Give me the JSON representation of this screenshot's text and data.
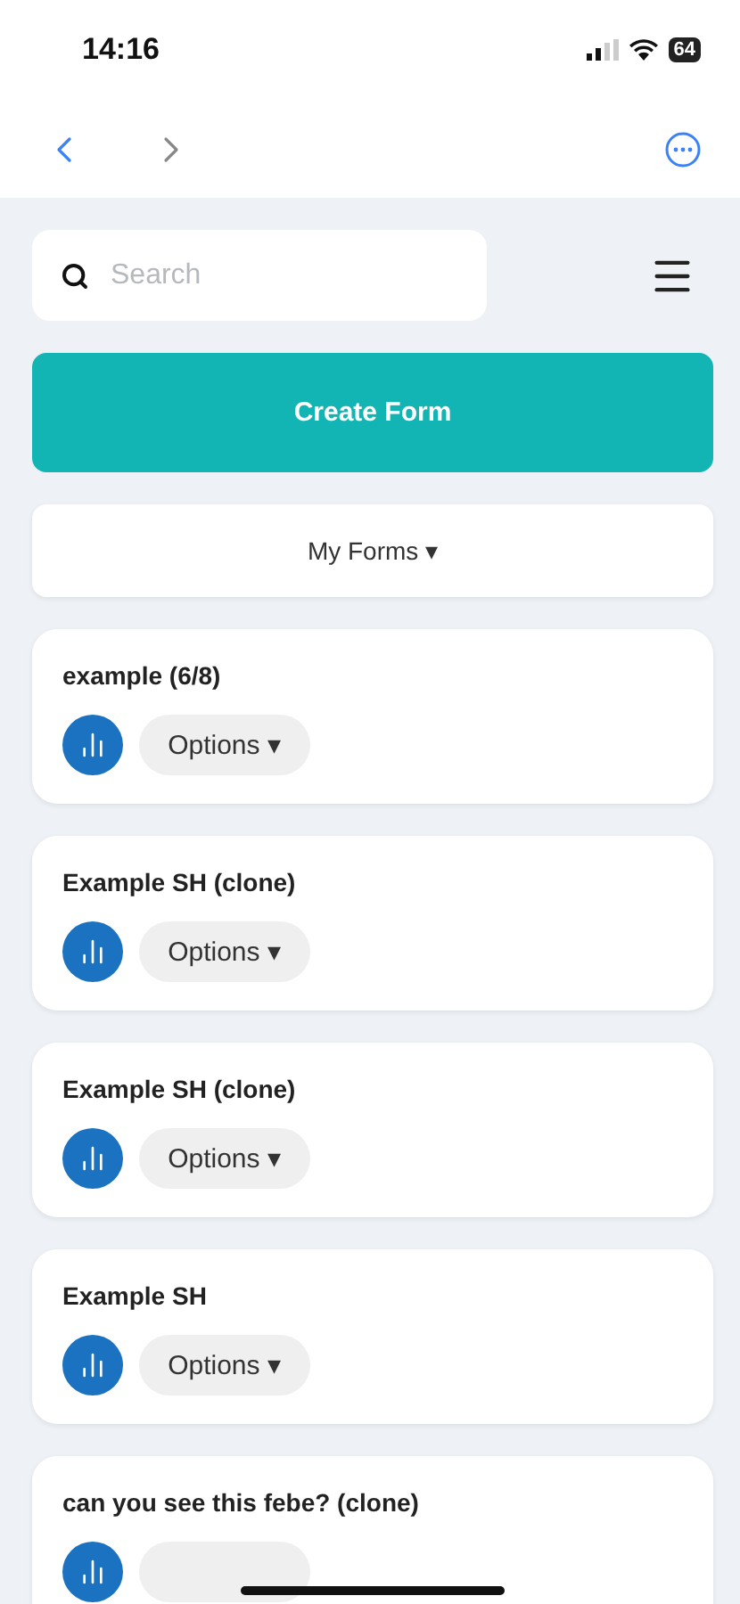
{
  "status_bar": {
    "time": "14:16",
    "battery": "64"
  },
  "search": {
    "placeholder": "Search"
  },
  "create_button": "Create Form",
  "filter": {
    "label": "My Forms",
    "caret": "▾"
  },
  "forms": [
    {
      "title": "example (6/8)",
      "options": "Options",
      "caret": "▾"
    },
    {
      "title": "Example SH (clone)",
      "options": "Options",
      "caret": "▾"
    },
    {
      "title": "Example SH (clone)",
      "options": "Options",
      "caret": "▾"
    },
    {
      "title": "Example SH",
      "options": "Options",
      "caret": "▾"
    },
    {
      "title": "can you see this febe? (clone)"
    }
  ]
}
